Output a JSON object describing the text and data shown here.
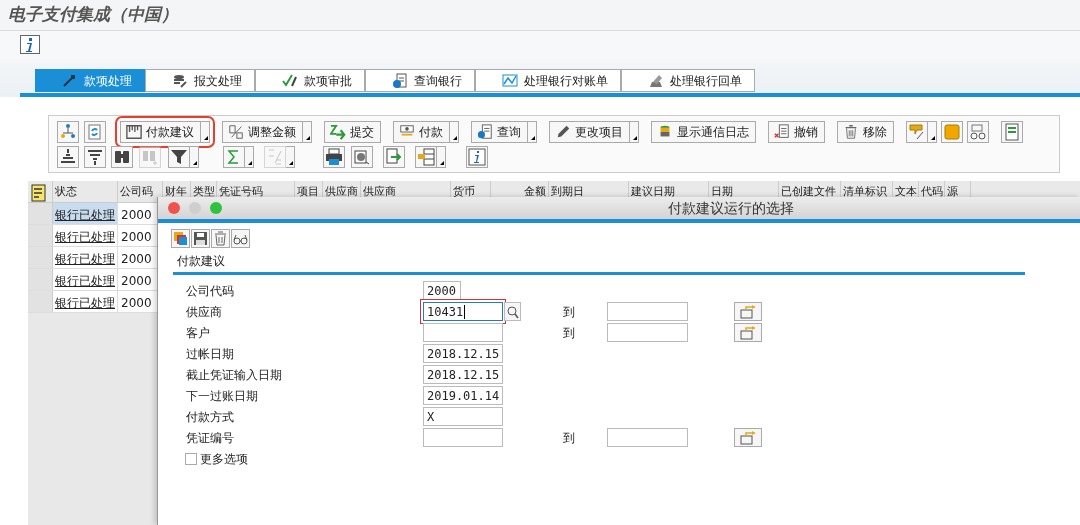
{
  "page_title": "电子支付集成（中国）",
  "tabs": [
    {
      "label": "款项处理",
      "selected": true
    },
    {
      "label": "报文处理",
      "selected": false
    },
    {
      "label": "款项审批",
      "selected": false
    },
    {
      "label": "查询银行",
      "selected": false
    },
    {
      "label": "处理银行对账单",
      "selected": false
    },
    {
      "label": "处理银行回单",
      "selected": false
    }
  ],
  "toolbar": {
    "row_1": [
      {
        "dropdown": false,
        "highlighted": false
      },
      {
        "dropdown": false,
        "highlighted": false
      },
      {
        "label": "付款建议",
        "dropdown": true,
        "highlighted": true
      },
      {
        "label": "调整金额",
        "dropdown": true,
        "highlighted": false
      },
      {
        "label": "提交",
        "dropdown": false,
        "highlighted": false
      },
      {
        "label": "付款",
        "dropdown": true,
        "highlighted": false
      },
      {
        "label": "查询",
        "dropdown": true,
        "highlighted": false
      },
      {
        "label": "更改项目",
        "dropdown": true,
        "highlighted": false
      },
      {
        "label": "显示通信日志",
        "dropdown": false,
        "highlighted": false
      },
      {
        "label": "撤销",
        "dropdown": false,
        "highlighted": false
      },
      {
        "label": "移除",
        "dropdown": false,
        "highlighted": false
      },
      {
        "dropdown": true,
        "highlighted": false
      },
      {
        "dropdown": false,
        "highlighted": false
      },
      {
        "dropdown": false,
        "highlighted": false
      },
      {
        "dropdown": false,
        "highlighted": false
      }
    ],
    "row_2": [
      {
        "dropdown": false,
        "disabled": false
      },
      {
        "dropdown": false,
        "disabled": false
      },
      {
        "dropdown": false,
        "disabled": false
      },
      {
        "dropdown": false,
        "disabled": true
      },
      {
        "dropdown": true,
        "disabled": false
      },
      {
        "dropdown": true,
        "disabled": false
      },
      {
        "dropdown": true,
        "disabled": true
      },
      {
        "dropdown": false,
        "disabled": false
      },
      {
        "dropdown": false,
        "disabled": false
      },
      {
        "dropdown": false,
        "disabled": false
      },
      {
        "dropdown": true,
        "disabled": false
      },
      {
        "dropdown": false,
        "disabled": false
      }
    ]
  },
  "table": {
    "columns": [
      "状态",
      "公司码",
      "财年",
      "类型",
      "凭证号码",
      "项目",
      "供应商",
      "供应商",
      "货币",
      "金额",
      "到期日",
      "建议日期",
      "日期",
      "已创建文件",
      "清单标识",
      "文本",
      "代码",
      "源"
    ],
    "rows": [
      {
        "status": "银行已处理",
        "company_code": "2000",
        "selected": true
      },
      {
        "status": "银行已处理",
        "company_code": "2000",
        "selected": false
      },
      {
        "status": "银行已处理",
        "company_code": "2000",
        "selected": false
      },
      {
        "status": "银行已处理",
        "company_code": "2000",
        "selected": false
      },
      {
        "status": "银行已处理",
        "company_code": "2000",
        "selected": false
      }
    ]
  },
  "dialog": {
    "title": "付款建议运行的选择",
    "section_title": "付款建议",
    "fields": [
      {
        "label": "公司代码",
        "value": "2000",
        "kind": "short",
        "range": false,
        "search_help": false,
        "focused": false
      },
      {
        "label": "供应商",
        "value": "10431",
        "kind": "long",
        "range": true,
        "to_label": "到",
        "search_help": true,
        "focused": true
      },
      {
        "label": "客户",
        "kind": "long",
        "range": true,
        "to_label": "到",
        "search_help": false,
        "focused": false
      },
      {
        "label": "过帐日期",
        "value": "2018.12.15",
        "kind": "long",
        "range": false,
        "search_help": false,
        "focused": false
      },
      {
        "label": "截止凭证输入日期",
        "value": "2018.12.15",
        "kind": "long",
        "range": false,
        "search_help": false,
        "focused": false
      },
      {
        "label": "下一过账日期",
        "value": "2019.01.14",
        "kind": "long",
        "range": false,
        "search_help": false,
        "focused": false
      },
      {
        "label": "付款方式",
        "value": "X",
        "kind": "long",
        "range": false,
        "search_help": false,
        "focused": false
      },
      {
        "label": "凭证编号",
        "kind": "long",
        "range": true,
        "to_label": "到",
        "search_help": false,
        "focused": false
      }
    ],
    "more_options": {
      "label": "更多选项",
      "checked": false
    }
  }
}
